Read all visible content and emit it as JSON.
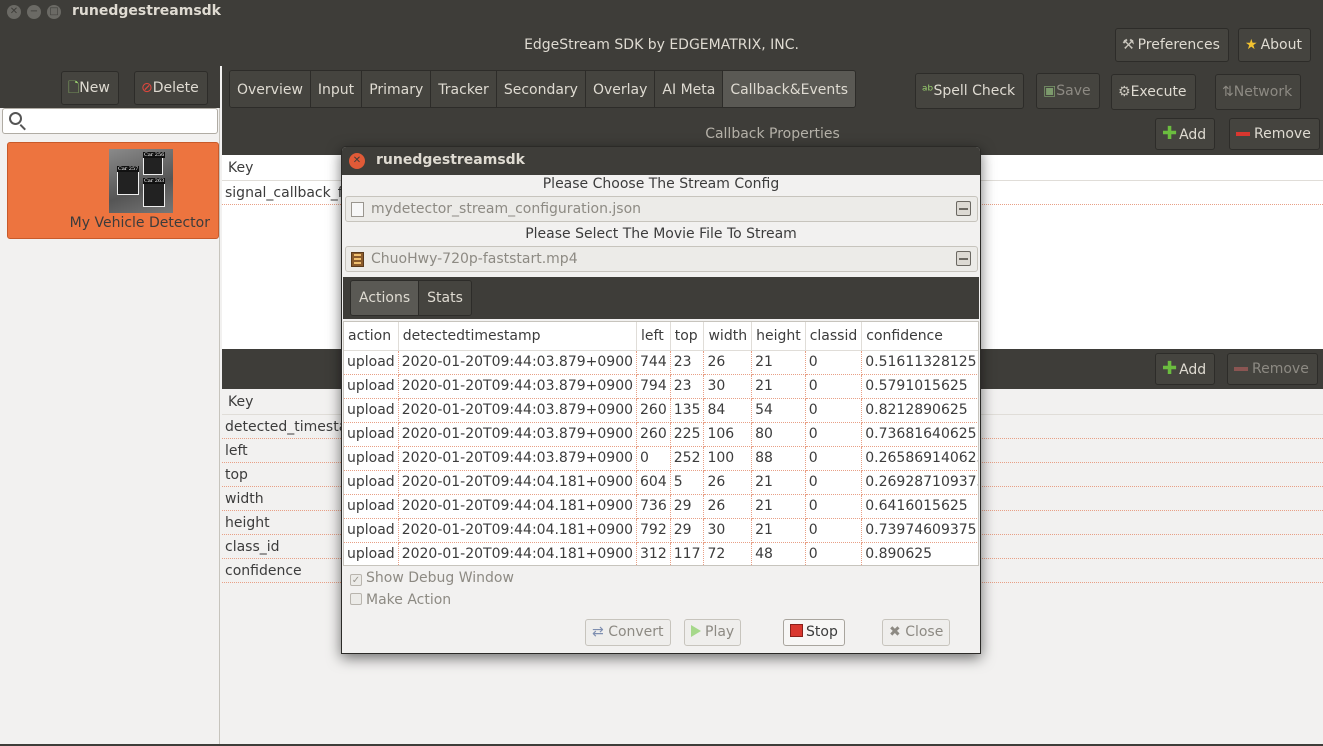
{
  "window": {
    "title": "runedgestreamsdk",
    "header_title": "EdgeStream SDK by EDGEMATRIX, INC.",
    "preferences_label": "Preferences",
    "about_label": "About"
  },
  "sidebar": {
    "new_label": "New",
    "delete_label": "Delete",
    "search_placeholder": "",
    "item": {
      "name": "My Vehicle Detector",
      "thumb_labels": [
        "Car 256",
        "Car 257",
        "Car 263"
      ]
    }
  },
  "main": {
    "tabs": [
      "Overview",
      "Input",
      "Primary",
      "Tracker",
      "Secondary",
      "Overlay",
      "AI Meta",
      "Callback&Events"
    ],
    "active_tab": "Callback&Events",
    "spellcheck_label": "Spell Check",
    "save_label": "Save",
    "execute_label": "Execute",
    "network_label": "Network",
    "callback_section": {
      "title": "Callback Properties",
      "add_label": "Add",
      "remove_label": "Remove",
      "key_header": "Key",
      "rows": [
        "signal_callback_f"
      ]
    },
    "event_section": {
      "add_label": "Add",
      "remove_label": "Remove",
      "key_header": "Key",
      "rows": [
        "detected_timesta",
        "left",
        "top",
        "width",
        "height",
        "class_id",
        "confidence"
      ]
    }
  },
  "dialog": {
    "title": "runedgestreamsdk",
    "config_prompt": "Please Choose The Stream Config",
    "config_file": "mydetector_stream_configuration.json",
    "movie_prompt": "Please Select The Movie File To Stream",
    "movie_file": "ChuoHwy-720p-faststart.mp4",
    "tabs": [
      "Actions",
      "Stats"
    ],
    "active_tab": "Actions",
    "table": {
      "columns": [
        "action",
        "detectedtimestamp",
        "left",
        "top",
        "width",
        "height",
        "classid",
        "confidence"
      ],
      "rows": [
        [
          "upload",
          "2020-01-20T09:44:03.879+0900",
          "744",
          "23",
          "26",
          "21",
          "0",
          "0.51611328125"
        ],
        [
          "upload",
          "2020-01-20T09:44:03.879+0900",
          "794",
          "23",
          "30",
          "21",
          "0",
          "0.5791015625"
        ],
        [
          "upload",
          "2020-01-20T09:44:03.879+0900",
          "260",
          "135",
          "84",
          "54",
          "0",
          "0.8212890625"
        ],
        [
          "upload",
          "2020-01-20T09:44:03.879+0900",
          "260",
          "225",
          "106",
          "80",
          "0",
          "0.73681640625"
        ],
        [
          "upload",
          "2020-01-20T09:44:03.879+0900",
          "0",
          "252",
          "100",
          "88",
          "0",
          "0.265869140625"
        ],
        [
          "upload",
          "2020-01-20T09:44:04.181+0900",
          "604",
          "5",
          "26",
          "21",
          "0",
          "0.269287109375"
        ],
        [
          "upload",
          "2020-01-20T09:44:04.181+0900",
          "736",
          "29",
          "26",
          "21",
          "0",
          "0.6416015625"
        ],
        [
          "upload",
          "2020-01-20T09:44:04.181+0900",
          "792",
          "29",
          "30",
          "21",
          "0",
          "0.73974609375"
        ],
        [
          "upload",
          "2020-01-20T09:44:04.181+0900",
          "312",
          "117",
          "72",
          "48",
          "0",
          "0.890625"
        ]
      ]
    },
    "show_debug_label": "Show Debug Window",
    "show_debug_checked": true,
    "make_action_label": "Make Action",
    "make_action_checked": false,
    "convert_label": "Convert",
    "play_label": "Play",
    "stop_label": "Stop",
    "close_label": "Close"
  },
  "colors": {
    "accent_orange": "#ed743f",
    "toolbar_dark": "#3e3d39",
    "stop_red": "#d9372f",
    "add_green": "#6bbd3f"
  }
}
